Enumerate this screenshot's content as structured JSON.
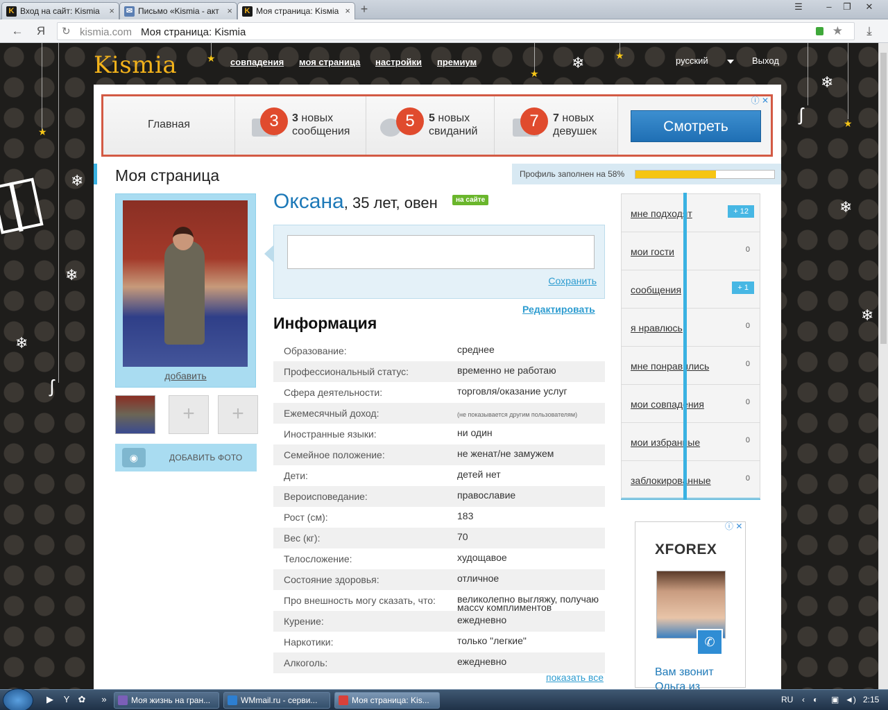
{
  "browser": {
    "tabs": [
      {
        "label": "Вход на сайт: Kismia",
        "icon": "kismia-icon"
      },
      {
        "label": "Письмо «Kismia - акт",
        "icon": "mail-icon"
      },
      {
        "label": "Моя страница: Kisмia",
        "icon": "kismia-icon"
      }
    ],
    "new_tab_symbol": "+",
    "domain": "kismia.com",
    "page_title": "Моя страница: Kismia"
  },
  "site": {
    "logo": "Kismia",
    "nav": [
      "совпадения",
      "моя страница",
      "настройки",
      "премиум"
    ],
    "language": "русский",
    "logout": "Выход"
  },
  "ad_banner": {
    "home": "Главная",
    "items": [
      {
        "badge": "3",
        "line1_bold": "3",
        "line1": " новых",
        "line2": "сообщения"
      },
      {
        "badge": "5",
        "line1_bold": "5",
        "line1": " новых",
        "line2": "свиданий"
      },
      {
        "badge": "7",
        "line1_bold": "7",
        "line1": " новых",
        "line2": "девушек"
      }
    ],
    "button": "Смотреть",
    "adchoice": "ⓘ ✕"
  },
  "profile": {
    "page_title": "Моя страница",
    "fill_label": "Профиль заполнен на 58%",
    "fill_fraction": 0.58,
    "name": "Оксана",
    "age_sign": ", 35 лет, овен",
    "online_badge": "на сайте",
    "add_photo_link": "добавить",
    "add_photo_button": "ДОБАВИТЬ ФОТО",
    "status_save": "Сохранить",
    "edit": "Редактировать",
    "info_heading": "Информация",
    "show_all": "показать все"
  },
  "info": [
    {
      "k": "Образование:",
      "v": "среднее"
    },
    {
      "k": "Профессиональный статус:",
      "v": "временно не работаю"
    },
    {
      "k": "Сфера деятельности:",
      "v": "торговля/оказание услуг"
    },
    {
      "k": "Ежемесячный доход:",
      "v": "(не показывается другим пользователям)"
    },
    {
      "k": "Иностранные языки:",
      "v": "ни один"
    },
    {
      "k": "Семейное положение:",
      "v": "не женат/не замужем"
    },
    {
      "k": "Дети:",
      "v": "детей нет"
    },
    {
      "k": "Вероисповедание:",
      "v": "православие"
    },
    {
      "k": "Рост (см):",
      "v": "183"
    },
    {
      "k": "Вес (кг):",
      "v": "70"
    },
    {
      "k": "Телосложение:",
      "v": "худощавое"
    },
    {
      "k": "Состояние здоровья:",
      "v": "отличное"
    },
    {
      "k": "Про внешность могу сказать, что:",
      "v": "великолепно выгляжу, получаю массу комплиментов"
    },
    {
      "k": "Курение:",
      "v": "ежедневно"
    },
    {
      "k": "Наркотики:",
      "v": "только \"легкие\""
    },
    {
      "k": "Алкоголь:",
      "v": "ежедневно"
    }
  ],
  "sidebar": [
    {
      "label": "мне подходят",
      "count": "+ 12",
      "highlight": true
    },
    {
      "label": "мои гости",
      "count": "0",
      "highlight": false
    },
    {
      "label": "сообщения",
      "count": "+ 1",
      "highlight": true
    },
    {
      "label": "я нравлюсь",
      "count": "0",
      "highlight": false
    },
    {
      "label": "мне понравились",
      "count": "0",
      "highlight": false
    },
    {
      "label": "мои совпадения",
      "count": "0",
      "highlight": false
    },
    {
      "label": "мои избранные",
      "count": "0",
      "highlight": false
    },
    {
      "label": "заблокированные",
      "count": "0",
      "highlight": false
    }
  ],
  "ad_side": {
    "brand": "XFOREX",
    "text": "Вам звонит Ольга из",
    "adchoice": "ⓘ ✕"
  },
  "taskbar": {
    "tasks": [
      "Моя жизнь на гран...",
      "WMmail.ru - серви...",
      "Моя страница: Kis..."
    ],
    "lang": "RU",
    "time": "2:15"
  },
  "colors": {
    "accent": "#3ab2e2",
    "badge": "#e04b2e",
    "fill": "#f6c513",
    "online": "#6ab62c"
  }
}
